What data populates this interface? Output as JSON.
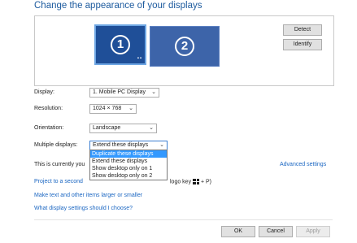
{
  "page": {
    "title": "Change the appearance of your displays"
  },
  "monitors": [
    {
      "number": "1",
      "selected": true
    },
    {
      "number": "2",
      "selected": false
    }
  ],
  "buttons": {
    "detect": "Detect",
    "identify": "Identify"
  },
  "form": {
    "display_label": "Display:",
    "display_value": "1. Mobile PC Display",
    "resolution_label": "Resolution:",
    "resolution_value": "1024 × 768",
    "orientation_label": "Orientation:",
    "orientation_value": "Landscape",
    "multiple_label": "Multiple displays:",
    "multiple_value": "Extend these displays"
  },
  "dropdown_options": [
    "Duplicate these displays",
    "Extend these displays",
    "Show desktop only on 1",
    "Show desktop only on 2"
  ],
  "dropdown_selected_index": 0,
  "status": {
    "current_text": "This is currently you",
    "advanced": "Advanced settings"
  },
  "links": {
    "project_prefix": "Project to a second",
    "project_suffix": "logo key",
    "project_plus": "+ P)",
    "larger": "Make text and other items larger or smaller",
    "which": "What display settings should I choose?"
  },
  "footer": {
    "ok": "OK",
    "cancel": "Cancel",
    "apply": "Apply"
  },
  "colors": {
    "accent": "#1c5a9e",
    "link": "#1a66c2",
    "monitor_selected": "#1f4f98",
    "monitor": "#3d64a9",
    "dropdown_highlight": "#3399ff"
  }
}
